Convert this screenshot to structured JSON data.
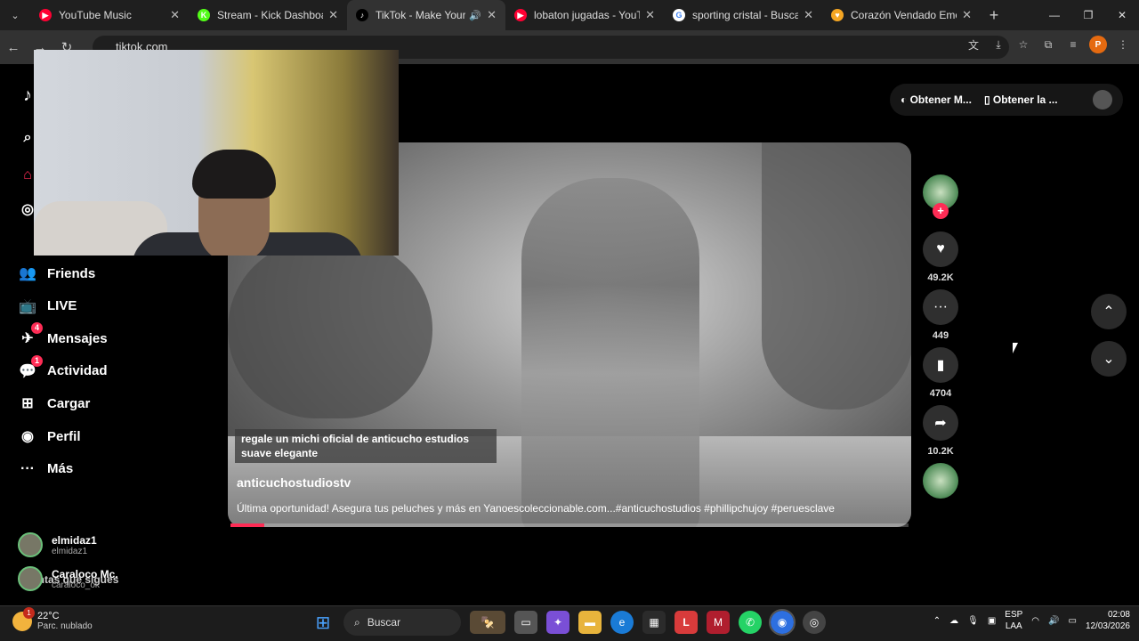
{
  "browser": {
    "tabs": [
      {
        "title": "YouTube Music",
        "favicon_color": "#ff0033",
        "favicon_glyph": "▶",
        "active": false
      },
      {
        "title": "Stream - Kick Dashboard",
        "favicon_color": "#53fc18",
        "favicon_glyph": "K",
        "active": false
      },
      {
        "title": "TikTok - Make Your Da",
        "favicon_color": "#000000",
        "favicon_glyph": "♪",
        "active": true
      },
      {
        "title": "lobaton jugadas - YouTube",
        "favicon_color": "#ff0033",
        "favicon_glyph": "▶",
        "active": false
      },
      {
        "title": "sporting cristal - Buscar co",
        "favicon_color": "#ffffff",
        "favicon_glyph": "G",
        "active": false
      },
      {
        "title": "Corazón Vendado Emo",
        "favicon_color": "#f5a623",
        "favicon_glyph": "♥",
        "active": false
      }
    ],
    "url": "tiktok.com",
    "profile_initial": "P"
  },
  "sidebar": {
    "items": [
      {
        "label": "Friends",
        "icon": "friends-icon",
        "glyph": "👥",
        "badge": ""
      },
      {
        "label": "LIVE",
        "icon": "live-icon",
        "glyph": "📺",
        "badge": ""
      },
      {
        "label": "Mensajes",
        "icon": "messages-icon",
        "glyph": "✈",
        "badge": "4"
      },
      {
        "label": "Actividad",
        "icon": "activity-icon",
        "glyph": "💬",
        "badge": "1"
      },
      {
        "label": "Cargar",
        "icon": "upload-icon",
        "glyph": "⊞",
        "badge": ""
      },
      {
        "label": "Perfil",
        "icon": "profile-icon",
        "glyph": "◉",
        "badge": ""
      },
      {
        "label": "Más",
        "icon": "more-icon",
        "glyph": "···",
        "badge": ""
      }
    ],
    "following_title": "Cuentas que sigues",
    "following": [
      {
        "name": "elmidaz1",
        "handle": "elmidaz1"
      },
      {
        "name": "Caraloco Mc.",
        "handle": "caraloco_ok"
      }
    ]
  },
  "header": {
    "button1": "Obtener M...",
    "button2": "Obtener la ..."
  },
  "video": {
    "caption": "regale un michi oficial de anticucho estudios suave elegante",
    "author": "anticuchostudiostv",
    "description": "Última oportunidad! Asegura tus peluches y más en Yanoescoleccionable.com...#anticuchostudios #phillipchujoy #peruesclave",
    "progress": 0.05
  },
  "actions": {
    "likes": "49.2K",
    "comments": "449",
    "saves": "4704",
    "shares": "10.2K"
  },
  "taskbar": {
    "weather_temp": "22°C",
    "weather_desc": "Parc. nublado",
    "weather_badge": "1",
    "search": "Buscar",
    "lang1": "ESP",
    "lang2": "LAA",
    "time": "02:08",
    "date": "12/03/2026"
  }
}
